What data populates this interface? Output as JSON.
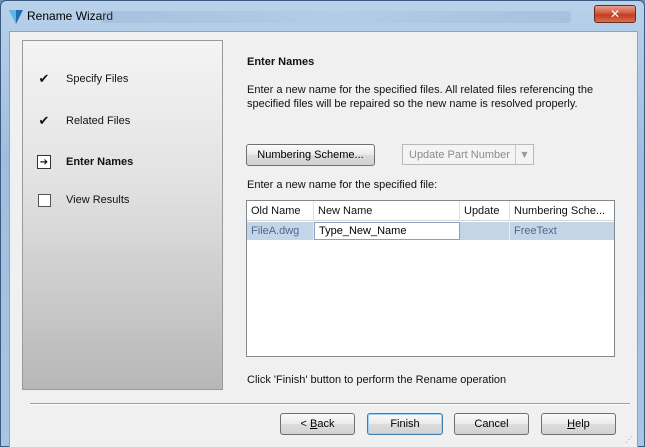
{
  "window": {
    "title": "Rename Wizard",
    "close_glyph": "✕",
    "icon": "autodesk-vault-icon"
  },
  "steps": [
    {
      "label": "Specify Files",
      "state": "done",
      "mark": "✔"
    },
    {
      "label": "Related Files",
      "state": "done",
      "mark": "✔"
    },
    {
      "label": "Enter Names",
      "state": "current",
      "mark": "➔"
    },
    {
      "label": "View Results",
      "state": "pending",
      "mark": ""
    }
  ],
  "content": {
    "heading": "Enter Names",
    "description": "Enter a new name for the specified files.  All related files referencing the specified files will be repaired so the new name is resolved properly.",
    "numbering_button": "Numbering Scheme...",
    "update_part_number": "Update Part Number",
    "prompt": "Enter a new name for the specified file:",
    "finish_note": "Click 'Finish' button to perform the Rename operation"
  },
  "table": {
    "columns": [
      "Old Name",
      "New Name",
      "Update",
      "Numbering Sche..."
    ],
    "rows": [
      {
        "old_name": "FileA.dwg",
        "new_name": "Type_New_Name",
        "update": "",
        "numbering_scheme": "FreeText"
      }
    ]
  },
  "buttons": {
    "back_prefix": "< ",
    "back_key": "B",
    "back_rest": "ack",
    "finish": "Finish",
    "cancel": "Cancel",
    "help_key": "H",
    "help_rest": "elp"
  },
  "colors": {
    "selection_row": "#c5d5e8",
    "close_button": "#c23b22",
    "default_button_border": "#3c7fb1"
  }
}
